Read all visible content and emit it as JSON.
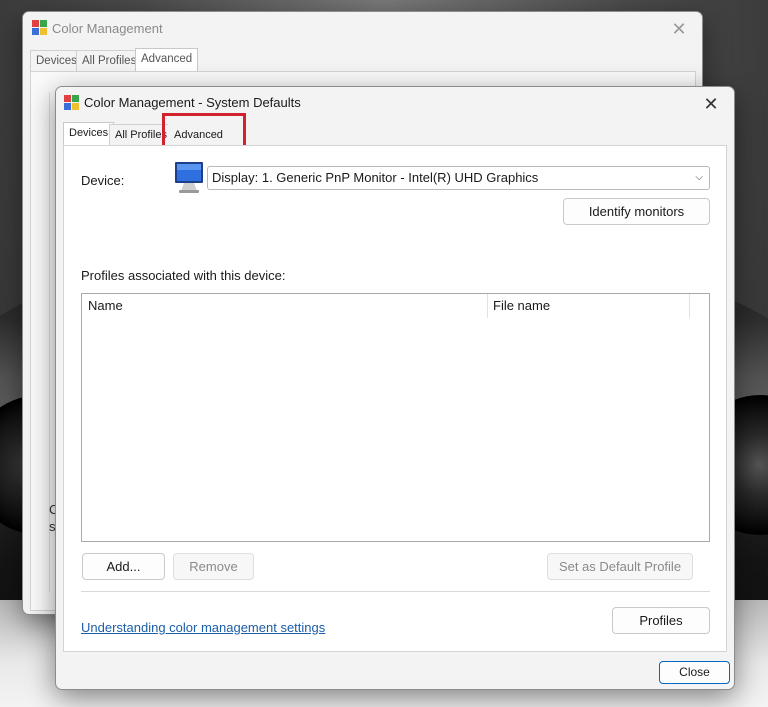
{
  "back_window": {
    "title": "Color Management",
    "tabs": [
      "Devices",
      "All Profiles",
      "Advanced"
    ],
    "fragment_1": "C",
    "fragment_2": "sy"
  },
  "front_window": {
    "title": "Color Management - System Defaults",
    "tabs": [
      "Devices",
      "All Profiles",
      "Advanced"
    ],
    "active_tab": "Devices",
    "highlighted_tab": "Advanced",
    "device_label": "Device:",
    "device_value": "Display: 1. Generic PnP Monitor - Intel(R) UHD Graphics",
    "identify_button": "Identify monitors",
    "profiles_label": "Profiles associated with this device:",
    "columns": [
      "Name",
      "File name"
    ],
    "rows": [],
    "add_button": "Add...",
    "remove_button": "Remove",
    "set_default_button": "Set as Default Profile",
    "help_link": "Understanding color management settings",
    "profiles_button": "Profiles",
    "close_button": "Close"
  },
  "colors": {
    "highlight": "#d0232e",
    "link": "#1c5ea8",
    "accent": "#0067c0"
  }
}
